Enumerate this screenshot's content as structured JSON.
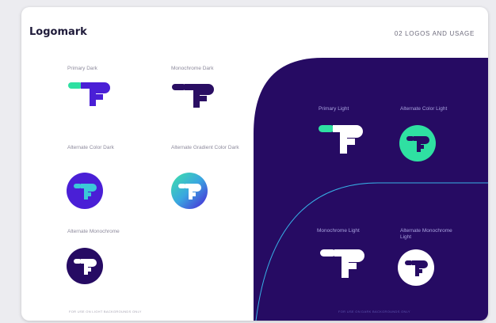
{
  "header": {
    "title": "Logomark",
    "section": "02 LOGOS AND USAGE"
  },
  "colors": {
    "purple": "#4a1fd6",
    "navy": "#2a0e63",
    "mint": "#2fe0a2",
    "cyan": "#3bc9d8",
    "panel": "#260b63",
    "divider": "#37b0e6",
    "white": "#ffffff"
  },
  "dark_variants": [
    {
      "label": "Primary Dark",
      "icon": "f-mark-primary-dark-icon"
    },
    {
      "label": "Monochrome Dark",
      "icon": "f-mark-monochrome-dark-icon"
    },
    {
      "label": "Alternate Color Dark",
      "icon": "f-badge-alternate-color-dark-icon"
    },
    {
      "label": "Alternate Gradient Color Dark",
      "icon": "f-badge-alternate-gradient-dark-icon"
    },
    {
      "label": "Alternate Monochrome",
      "icon": "f-badge-alternate-monochrome-icon"
    }
  ],
  "light_variants": [
    {
      "label": "Primary Light",
      "icon": "f-mark-primary-light-icon"
    },
    {
      "label": "Alternate Color Light",
      "icon": "f-badge-alternate-color-light-icon"
    },
    {
      "label": "Monochrome Light",
      "icon": "f-mark-monochrome-light-icon"
    },
    {
      "label": "Alternate Monochrome Light",
      "icon": "f-badge-alternate-monochrome-light-icon"
    }
  ],
  "footnotes": {
    "light_bg": "FOR USE ON LIGHT BACKGROUNDS ONLY",
    "dark_bg": "FOR USE ON DARK BACKGROUNDS ONLY"
  }
}
